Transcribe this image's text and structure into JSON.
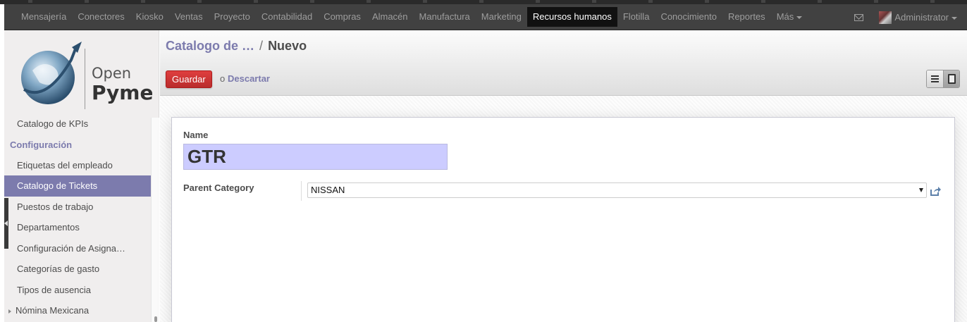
{
  "menu": {
    "items": [
      {
        "label": "Mensajería",
        "active": false
      },
      {
        "label": "Conectores",
        "active": false
      },
      {
        "label": "Kiosko",
        "active": false
      },
      {
        "label": "Ventas",
        "active": false
      },
      {
        "label": "Proyecto",
        "active": false
      },
      {
        "label": "Contabilidad",
        "active": false
      },
      {
        "label": "Compras",
        "active": false
      },
      {
        "label": "Almacén",
        "active": false
      },
      {
        "label": "Manufactura",
        "active": false
      },
      {
        "label": "Marketing",
        "active": false
      },
      {
        "label": "Recursos humanos",
        "active": true
      },
      {
        "label": "Flotilla",
        "active": false
      },
      {
        "label": "Conocimiento",
        "active": false
      },
      {
        "label": "Reportes",
        "active": false
      }
    ],
    "more_label": "Más",
    "user": "Administrator"
  },
  "logo": {
    "line1": "Open",
    "line2": "Pyme"
  },
  "sidebar": {
    "top_item": "Catalogo de KPIs",
    "section": "Configuración",
    "items": [
      {
        "label": "Etiquetas del empleado",
        "selected": false
      },
      {
        "label": "Catalogo de Tickets",
        "selected": true
      },
      {
        "label": "Puestos de trabajo",
        "selected": false
      },
      {
        "label": "Departamentos",
        "selected": false
      },
      {
        "label": "Configuración de Asigna…",
        "selected": false
      },
      {
        "label": "Categorías de gasto",
        "selected": false
      },
      {
        "label": "Tipos de ausencia",
        "selected": false
      }
    ],
    "collapsed_item": "Nómina Mexicana"
  },
  "breadcrumb": {
    "parent": "Catalogo de …",
    "separator": "/",
    "current": "Nuevo"
  },
  "actions": {
    "save": "Guardar",
    "or": "o",
    "discard": "Descartar"
  },
  "form": {
    "name_label": "Name",
    "name_value": "GTR",
    "parent_label": "Parent Category",
    "parent_value": "NISSAN"
  },
  "colors": {
    "accent": "#7c7bad",
    "save_button": "#c9302c",
    "navbar": "#414141",
    "name_field": "#ccccff"
  }
}
